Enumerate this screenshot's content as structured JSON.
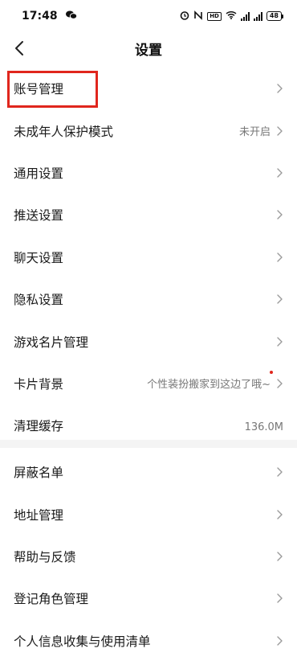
{
  "status_bar": {
    "time": "17:48",
    "wechat_icon": "wechat-icon",
    "battery": "48",
    "icons": [
      "alarm-icon",
      "nfc-icon",
      "hd-icon",
      "wifi-icon",
      "signal-icon",
      "signal-icon",
      "battery-icon"
    ],
    "hd_label": "HD"
  },
  "nav": {
    "title": "设置",
    "back_icon": "chevron-left-icon"
  },
  "settings_group_1": [
    {
      "label": "账号管理",
      "value": ""
    },
    {
      "label": "未成年人保护模式",
      "value": "未开启"
    },
    {
      "label": "通用设置",
      "value": ""
    },
    {
      "label": "推送设置",
      "value": ""
    },
    {
      "label": "聊天设置",
      "value": ""
    },
    {
      "label": "隐私设置",
      "value": ""
    },
    {
      "label": "游戏名片管理",
      "value": ""
    },
    {
      "label": "卡片背景",
      "value": "个性装扮搬家到这边了哦~"
    },
    {
      "label": "清理缓存",
      "value": "136.0M"
    }
  ],
  "settings_group_2": [
    {
      "label": "屏蔽名单",
      "value": ""
    },
    {
      "label": "地址管理",
      "value": ""
    },
    {
      "label": "帮助与反馈",
      "value": ""
    },
    {
      "label": "登记角色管理",
      "value": ""
    },
    {
      "label": "个人信息收集与使用清单",
      "value": ""
    }
  ],
  "colors": {
    "highlight": "#e0261d",
    "separator": "#f4f4f4",
    "secondary_text": "#777777"
  }
}
